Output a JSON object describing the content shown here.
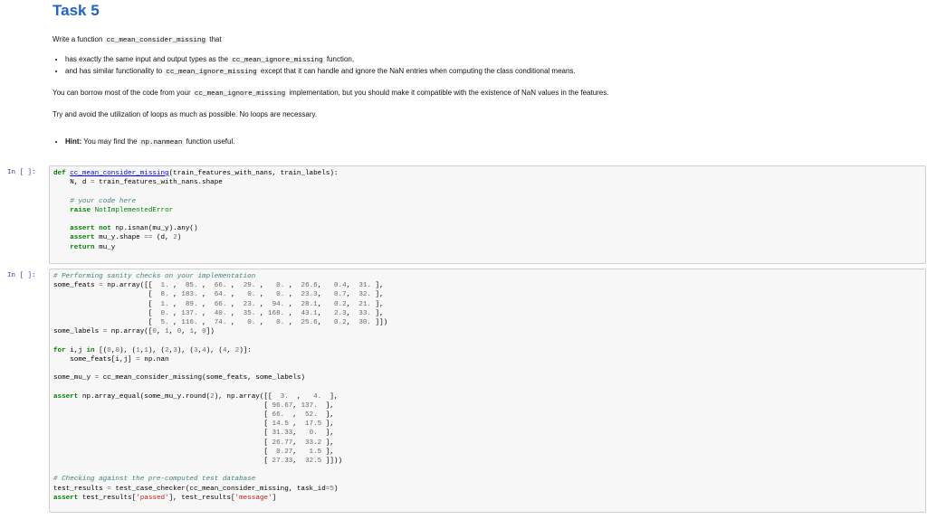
{
  "title": "Task 5",
  "intro": {
    "prefix": "Write a function ",
    "fn_name": "cc_mean_consider_missing",
    "suffix": " that"
  },
  "bullets": [
    {
      "text": "has exactly the same input and output types as the ",
      "code": "cc_mean_ignore_missing",
      "after": " function,"
    },
    {
      "text": "and has similar functionality to ",
      "code": "cc_mean_ignore_missing",
      "after": " except that it can handle and ignore the NaN entries when computing the class conditional means."
    }
  ],
  "borrow": {
    "prefix": "You can borrow most of the code from your ",
    "code": "cc_mean_ignore_missing",
    "suffix": " implementation, but you should make it compatible with the existence of NaN values in the features."
  },
  "loops_note": "Try and avoid the utilization of loops as much as possible. No loops are necessary.",
  "hint": {
    "label": "Hint:",
    "prefix": " You may find the ",
    "code": "np.nanmean",
    "suffix": " function useful."
  },
  "cell1": {
    "prompt": "In [ ]:",
    "lines": [
      "def cc_mean_consider_missing(train_features_with_nans, train_labels):",
      "    N, d = train_features_with_nans.shape",
      "",
      "    # your code here",
      "    raise NotImplementedError",
      "",
      "    assert not np.isnan(mu_y).any()",
      "    assert mu_y.shape == (d, 2)",
      "    return mu_y"
    ]
  },
  "cell2": {
    "prompt": "In [ ]:",
    "lines": [
      "# Performing sanity checks on your implementation",
      "some_feats = np.array([[  1. ,  85. ,  66. ,  29. ,   0. ,  26.6,   0.4,  31. ],",
      "                       [  8. , 183. ,  64. ,   0. ,   0. ,  23.3,   0.7,  32. ],",
      "                       [  1. ,  89. ,  66. ,  23. ,  94. ,  28.1,   0.2,  21. ],",
      "                       [  0. , 137. ,  40. ,  35. , 168. ,  43.1,   2.3,  33. ],",
      "                       [  5. , 116. ,  74. ,   0. ,   0. ,  25.6,   0.2,  30. ]])",
      "some_labels = np.array([0, 1, 0, 1, 0])",
      "",
      "for i,j in [(0,0), (1,1), (2,3), (3,4), (4, 2)]:",
      "    some_feats[i,j] = np.nan",
      "",
      "some_mu_y = cc_mean_consider_missing(some_feats, some_labels)",
      "",
      "assert np.array_equal(some_mu_y.round(2), np.array([[  3.  ,   4.  ],",
      "                                                   [ 96.67, 137.  ],",
      "                                                   [ 66.  ,  52.  ],",
      "                                                   [ 14.5 ,  17.5 ],",
      "                                                   [ 31.33,   0.  ],",
      "                                                   [ 26.77,  33.2 ],",
      "                                                   [  0.27,   1.5 ],",
      "                                                   [ 27.33,  32.5 ]]))",
      "",
      "# Checking against the pre-computed test database",
      "test_results = test_case_checker(cc_mean_consider_missing, task_id=5)",
      "assert test_results['passed'], test_results['message']"
    ]
  }
}
